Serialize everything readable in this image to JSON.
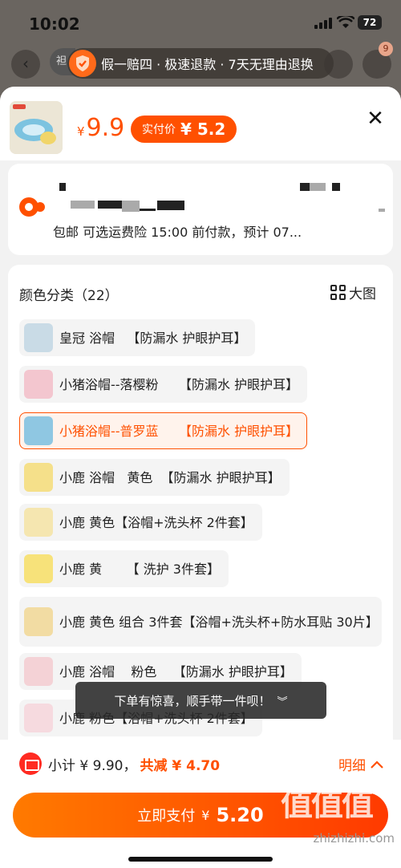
{
  "status_bar": {
    "time": "10:02",
    "battery": "72"
  },
  "background": {
    "search_fragment": "袒",
    "cart_badge": "9"
  },
  "guarantee": {
    "text": "假一赔四 · 极速退款 · 7天无理由退换"
  },
  "header": {
    "price_currency": "¥",
    "price": "9.9",
    "pay_label": "实付价",
    "pay_amount": "¥ 5.2"
  },
  "shipping": {
    "text": "包邮  可选运费险  15:00 前付款，预计 07..."
  },
  "variants": {
    "title": "颜色分类（22）",
    "big_image_label": "大图",
    "options": [
      {
        "label": "皇冠 浴帽   【防漏水 护眼护耳】",
        "selected": false,
        "thumb": "#c9dbe6"
      },
      {
        "label": "小猪浴帽--落樱粉     【防漏水 护眼护耳】",
        "selected": false,
        "thumb": "#f3c6cf"
      },
      {
        "label": "小猪浴帽--普罗蓝     【防漏水 护眼护耳】",
        "selected": true,
        "thumb": "#8fc7e2"
      },
      {
        "label": "小鹿 浴帽   黄色  【防漏水 护眼护耳】",
        "selected": false,
        "thumb": "#f5e08a"
      },
      {
        "label": "小鹿 黄色【浴帽+洗头杯 2件套】",
        "selected": false,
        "thumb": "#f5e6b0"
      },
      {
        "label": "小鹿 黄      【 洗护 3件套】",
        "selected": false,
        "thumb": "#f7e27a"
      },
      {
        "label": "小鹿  黄色 组合 3件套【浴帽+洗头杯+防水耳贴 30片】",
        "selected": false,
        "thumb": "#f2dca3"
      },
      {
        "label": "小鹿 浴帽    粉色    【防漏水 护眼护耳】",
        "selected": false,
        "thumb": "#f4d2d6"
      },
      {
        "label": "小鹿 粉色【浴帽+洗头杯 2件套】",
        "selected": false,
        "thumb": "#f6dadf"
      }
    ]
  },
  "toast": {
    "text": "下单有惊喜，顺手带一件呗！",
    "icon": "chevron-double-down"
  },
  "footer": {
    "subtotal": "小计 ¥ 9.90，",
    "discount": "共减 ¥ 4.70",
    "detail_label": "明细",
    "pay_label": "立即支付",
    "pay_currency": "¥",
    "pay_amount": "5.20"
  },
  "watermark": {
    "chars": "值值值",
    "url": "zhizhizhi.com"
  },
  "colors": {
    "accent": "#ff5000",
    "danger": "#ff2b22"
  }
}
